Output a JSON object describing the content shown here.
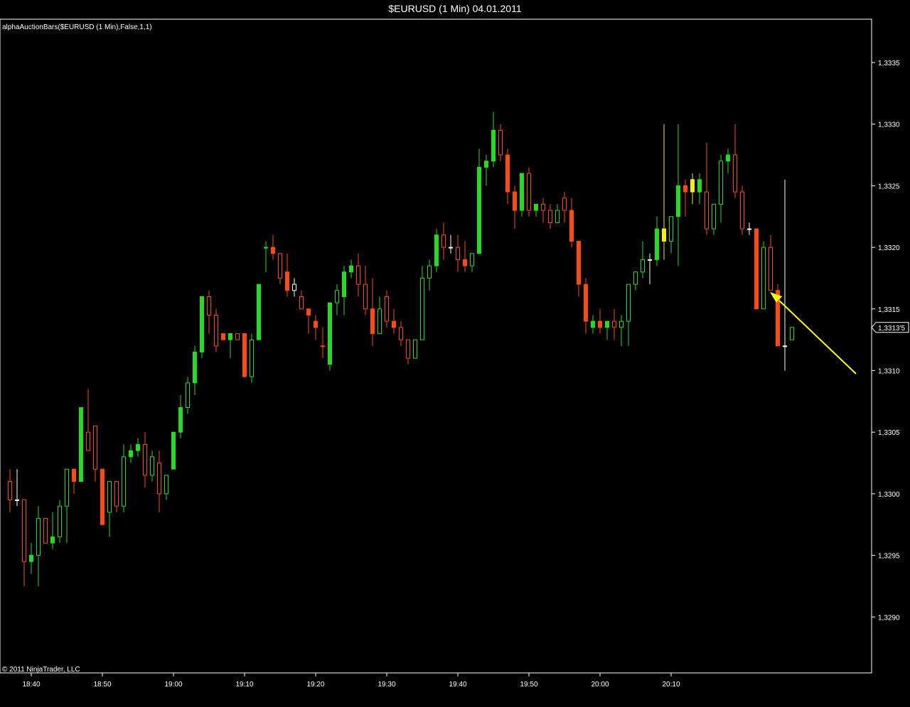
{
  "window": {
    "title": "$EURUSD (1 Min)  04.01.2011",
    "indicator_label": "alphaAuctionBars($EURUSD (1 Min),False,1,1)",
    "copyright": "© 2011 NinjaTrader, LLC",
    "current_price_label": "1,3313'5"
  },
  "colors": {
    "background": "#000000",
    "up": "#22dd22",
    "down": "#ff4a14",
    "neutral": "#ffffff",
    "yellow": "#ffee00",
    "arrow": "#ffff00",
    "axis": "#ffffff"
  },
  "chart_data": {
    "type": "candlestick",
    "title": "$EURUSD (1 Min)  04.01.2011",
    "x_tick_labels": [
      "18:40",
      "18:50",
      "19:00",
      "19:10",
      "19:20",
      "19:30",
      "19:40",
      "19:50",
      "20:00",
      "20:10"
    ],
    "y_tick_labels": [
      "1,3290",
      "1,3295",
      "1,3300",
      "1,3305",
      "1,3310",
      "1,3315",
      "1,3320",
      "1,3325",
      "1,3330",
      "1,3335"
    ],
    "y_ticks": [
      1.329,
      1.3295,
      1.33,
      1.3305,
      1.331,
      1.3315,
      1.332,
      1.3325,
      1.333,
      1.3335
    ],
    "ylim": [
      1.32845,
      1.33385
    ],
    "x_range_minutes": [
      -4,
      105
    ],
    "current_price": 1.33135,
    "annotation": "yellow arrow pointing at the last bar",
    "candles": [
      {
        "t": -3,
        "o": 1.3301,
        "h": 1.3302,
        "l": 1.32985,
        "c": 1.32995,
        "s": "down",
        "f": 0
      },
      {
        "t": -2,
        "o": 1.32995,
        "h": 1.3302,
        "l": 1.3299,
        "c": 1.32995,
        "s": "neutral",
        "f": 0
      },
      {
        "t": -1,
        "o": 1.32995,
        "h": 1.32995,
        "l": 1.32925,
        "c": 1.32945,
        "s": "down",
        "f": 0
      },
      {
        "t": 0,
        "o": 1.32945,
        "h": 1.3296,
        "l": 1.32935,
        "c": 1.3295,
        "s": "up",
        "f": 1
      },
      {
        "t": 1,
        "o": 1.3295,
        "h": 1.3299,
        "l": 1.32925,
        "c": 1.3298,
        "s": "up",
        "f": 0
      },
      {
        "t": 2,
        "o": 1.3298,
        "h": 1.3298,
        "l": 1.3296,
        "c": 1.3296,
        "s": "down",
        "f": 0
      },
      {
        "t": 3,
        "o": 1.3296,
        "h": 1.32985,
        "l": 1.32955,
        "c": 1.32965,
        "s": "up",
        "f": 1
      },
      {
        "t": 4,
        "o": 1.32965,
        "h": 1.32995,
        "l": 1.3296,
        "c": 1.3299,
        "s": "up",
        "f": 0
      },
      {
        "t": 5,
        "o": 1.3299,
        "h": 1.3302,
        "l": 1.3296,
        "c": 1.3302,
        "s": "up",
        "f": 0
      },
      {
        "t": 6,
        "o": 1.3302,
        "h": 1.3302,
        "l": 1.33,
        "c": 1.3301,
        "s": "down",
        "f": 1
      },
      {
        "t": 7,
        "o": 1.3301,
        "h": 1.3307,
        "l": 1.3301,
        "c": 1.3307,
        "s": "up",
        "f": 1
      },
      {
        "t": 8,
        "o": 1.3305,
        "h": 1.33085,
        "l": 1.33035,
        "c": 1.33035,
        "s": "down",
        "f": 0
      },
      {
        "t": 9,
        "o": 1.33055,
        "h": 1.33055,
        "l": 1.3301,
        "c": 1.3302,
        "s": "down",
        "f": 0
      },
      {
        "t": 10,
        "o": 1.3302,
        "h": 1.3302,
        "l": 1.32975,
        "c": 1.32975,
        "s": "down",
        "f": 1
      },
      {
        "t": 11,
        "o": 1.32985,
        "h": 1.3301,
        "l": 1.32965,
        "c": 1.3301,
        "s": "up",
        "f": 0
      },
      {
        "t": 12,
        "o": 1.3301,
        "h": 1.3301,
        "l": 1.32985,
        "c": 1.3299,
        "s": "down",
        "f": 0
      },
      {
        "t": 13,
        "o": 1.3299,
        "h": 1.3304,
        "l": 1.32985,
        "c": 1.3303,
        "s": "up",
        "f": 0
      },
      {
        "t": 14,
        "o": 1.3303,
        "h": 1.3304,
        "l": 1.33025,
        "c": 1.33035,
        "s": "up",
        "f": 1
      },
      {
        "t": 15,
        "o": 1.33035,
        "h": 1.33045,
        "l": 1.3303,
        "c": 1.3304,
        "s": "up",
        "f": 1
      },
      {
        "t": 16,
        "o": 1.3304,
        "h": 1.3305,
        "l": 1.33005,
        "c": 1.33015,
        "s": "down",
        "f": 0
      },
      {
        "t": 17,
        "o": 1.33015,
        "h": 1.33035,
        "l": 1.3301,
        "c": 1.3303,
        "s": "up",
        "f": 0
      },
      {
        "t": 18,
        "o": 1.33025,
        "h": 1.33035,
        "l": 1.32985,
        "c": 1.33,
        "s": "down",
        "f": 0
      },
      {
        "t": 19,
        "o": 1.33,
        "h": 1.33015,
        "l": 1.32995,
        "c": 1.33015,
        "s": "up",
        "f": 0
      },
      {
        "t": 20,
        "o": 1.3302,
        "h": 1.3305,
        "l": 1.3302,
        "c": 1.3305,
        "s": "up",
        "f": 1
      },
      {
        "t": 21,
        "o": 1.3305,
        "h": 1.3308,
        "l": 1.33045,
        "c": 1.3307,
        "s": "up",
        "f": 1
      },
      {
        "t": 22,
        "o": 1.3307,
        "h": 1.33095,
        "l": 1.33065,
        "c": 1.3309,
        "s": "up",
        "f": 0
      },
      {
        "t": 23,
        "o": 1.3309,
        "h": 1.3312,
        "l": 1.3308,
        "c": 1.33115,
        "s": "up",
        "f": 1
      },
      {
        "t": 24,
        "o": 1.33115,
        "h": 1.3316,
        "l": 1.3311,
        "c": 1.3316,
        "s": "up",
        "f": 1
      },
      {
        "t": 25,
        "o": 1.3316,
        "h": 1.33165,
        "l": 1.3313,
        "c": 1.33145,
        "s": "down",
        "f": 0
      },
      {
        "t": 26,
        "o": 1.33145,
        "h": 1.3315,
        "l": 1.33115,
        "c": 1.3312,
        "s": "down",
        "f": 0
      },
      {
        "t": 27,
        "o": 1.3313,
        "h": 1.3313,
        "l": 1.33125,
        "c": 1.33125,
        "s": "down",
        "f": 1
      },
      {
        "t": 28,
        "o": 1.33125,
        "h": 1.3313,
        "l": 1.3311,
        "c": 1.3313,
        "s": "up",
        "f": 1
      },
      {
        "t": 29,
        "o": 1.3313,
        "h": 1.3313,
        "l": 1.33125,
        "c": 1.33125,
        "s": "down",
        "f": 0
      },
      {
        "t": 30,
        "o": 1.3313,
        "h": 1.3313,
        "l": 1.33095,
        "c": 1.33095,
        "s": "down",
        "f": 1
      },
      {
        "t": 31,
        "o": 1.33095,
        "h": 1.3313,
        "l": 1.3309,
        "c": 1.33125,
        "s": "up",
        "f": 0
      },
      {
        "t": 32,
        "o": 1.33125,
        "h": 1.3317,
        "l": 1.33125,
        "c": 1.3317,
        "s": "up",
        "f": 1
      },
      {
        "t": 33,
        "o": 1.332,
        "h": 1.33205,
        "l": 1.3318,
        "c": 1.332,
        "s": "up",
        "f": 1
      },
      {
        "t": 34,
        "o": 1.332,
        "h": 1.3321,
        "l": 1.3319,
        "c": 1.33195,
        "s": "down",
        "f": 1
      },
      {
        "t": 35,
        "o": 1.33195,
        "h": 1.3319,
        "l": 1.3317,
        "c": 1.33175,
        "s": "down",
        "f": 0
      },
      {
        "t": 36,
        "o": 1.3318,
        "h": 1.33195,
        "l": 1.3316,
        "c": 1.33165,
        "s": "down",
        "f": 1
      },
      {
        "t": 37,
        "o": 1.33165,
        "h": 1.33175,
        "l": 1.3316,
        "c": 1.3317,
        "s": "neutral",
        "f": 0
      },
      {
        "t": 38,
        "o": 1.3316,
        "h": 1.33165,
        "l": 1.3315,
        "c": 1.3315,
        "s": "down",
        "f": 0
      },
      {
        "t": 39,
        "o": 1.3315,
        "h": 1.3315,
        "l": 1.3313,
        "c": 1.33145,
        "s": "down",
        "f": 1
      },
      {
        "t": 40,
        "o": 1.3314,
        "h": 1.33145,
        "l": 1.33125,
        "c": 1.33135,
        "s": "down",
        "f": 1
      },
      {
        "t": 41,
        "o": 1.3312,
        "h": 1.33135,
        "l": 1.3311,
        "c": 1.3312,
        "s": "down",
        "f": 1
      },
      {
        "t": 42,
        "o": 1.33105,
        "h": 1.33155,
        "l": 1.331,
        "c": 1.33155,
        "s": "up",
        "f": 1
      },
      {
        "t": 43,
        "o": 1.33155,
        "h": 1.3317,
        "l": 1.33145,
        "c": 1.33165,
        "s": "up",
        "f": 0
      },
      {
        "t": 44,
        "o": 1.3316,
        "h": 1.33185,
        "l": 1.33145,
        "c": 1.3318,
        "s": "up",
        "f": 1
      },
      {
        "t": 45,
        "o": 1.3318,
        "h": 1.3319,
        "l": 1.33175,
        "c": 1.33185,
        "s": "up",
        "f": 1
      },
      {
        "t": 46,
        "o": 1.33185,
        "h": 1.33195,
        "l": 1.3316,
        "c": 1.3317,
        "s": "down",
        "f": 0
      },
      {
        "t": 47,
        "o": 1.3317,
        "h": 1.33185,
        "l": 1.33145,
        "c": 1.3315,
        "s": "down",
        "f": 0
      },
      {
        "t": 48,
        "o": 1.3315,
        "h": 1.33175,
        "l": 1.3312,
        "c": 1.3313,
        "s": "down",
        "f": 1
      },
      {
        "t": 49,
        "o": 1.3313,
        "h": 1.3316,
        "l": 1.3313,
        "c": 1.3315,
        "s": "up",
        "f": 0
      },
      {
        "t": 50,
        "o": 1.3316,
        "h": 1.33165,
        "l": 1.33135,
        "c": 1.3314,
        "s": "down",
        "f": 0
      },
      {
        "t": 51,
        "o": 1.3314,
        "h": 1.3315,
        "l": 1.3313,
        "c": 1.33135,
        "s": "down",
        "f": 1
      },
      {
        "t": 52,
        "o": 1.33135,
        "h": 1.3314,
        "l": 1.3312,
        "c": 1.33125,
        "s": "down",
        "f": 0
      },
      {
        "t": 53,
        "o": 1.33125,
        "h": 1.33125,
        "l": 1.33105,
        "c": 1.3311,
        "s": "down",
        "f": 0
      },
      {
        "t": 54,
        "o": 1.3311,
        "h": 1.33125,
        "l": 1.3311,
        "c": 1.33125,
        "s": "up",
        "f": 0
      },
      {
        "t": 55,
        "o": 1.33125,
        "h": 1.33185,
        "l": 1.33125,
        "c": 1.33175,
        "s": "up",
        "f": 0
      },
      {
        "t": 56,
        "o": 1.33175,
        "h": 1.3319,
        "l": 1.33165,
        "c": 1.33185,
        "s": "up",
        "f": 0
      },
      {
        "t": 57,
        "o": 1.33185,
        "h": 1.33215,
        "l": 1.3318,
        "c": 1.3321,
        "s": "up",
        "f": 1
      },
      {
        "t": 58,
        "o": 1.3321,
        "h": 1.3322,
        "l": 1.3319,
        "c": 1.332,
        "s": "down",
        "f": 0
      },
      {
        "t": 59,
        "o": 1.332,
        "h": 1.3321,
        "l": 1.33195,
        "c": 1.332,
        "s": "neutral",
        "f": 0
      },
      {
        "t": 60,
        "o": 1.332,
        "h": 1.3321,
        "l": 1.3318,
        "c": 1.3319,
        "s": "down",
        "f": 0
      },
      {
        "t": 61,
        "o": 1.3319,
        "h": 1.33205,
        "l": 1.3318,
        "c": 1.33185,
        "s": "down",
        "f": 1
      },
      {
        "t": 62,
        "o": 1.33185,
        "h": 1.33195,
        "l": 1.3318,
        "c": 1.33195,
        "s": "up",
        "f": 0
      },
      {
        "t": 63,
        "o": 1.33195,
        "h": 1.3328,
        "l": 1.33195,
        "c": 1.33265,
        "s": "up",
        "f": 1
      },
      {
        "t": 64,
        "o": 1.33265,
        "h": 1.33275,
        "l": 1.3325,
        "c": 1.3327,
        "s": "up",
        "f": 1
      },
      {
        "t": 65,
        "o": 1.3327,
        "h": 1.3331,
        "l": 1.33265,
        "c": 1.33295,
        "s": "up",
        "f": 1
      },
      {
        "t": 66,
        "o": 1.33295,
        "h": 1.333,
        "l": 1.3327,
        "c": 1.33275,
        "s": "down",
        "f": 0
      },
      {
        "t": 67,
        "o": 1.33275,
        "h": 1.3328,
        "l": 1.33235,
        "c": 1.33245,
        "s": "down",
        "f": 1
      },
      {
        "t": 68,
        "o": 1.33245,
        "h": 1.3325,
        "l": 1.33215,
        "c": 1.3323,
        "s": "down",
        "f": 1
      },
      {
        "t": 69,
        "o": 1.3323,
        "h": 1.3326,
        "l": 1.33225,
        "c": 1.3326,
        "s": "up",
        "f": 1
      },
      {
        "t": 70,
        "o": 1.3326,
        "h": 1.33265,
        "l": 1.33225,
        "c": 1.3323,
        "s": "down",
        "f": 0
      },
      {
        "t": 71,
        "o": 1.3323,
        "h": 1.33235,
        "l": 1.33225,
        "c": 1.33235,
        "s": "up",
        "f": 1
      },
      {
        "t": 72,
        "o": 1.33235,
        "h": 1.3324,
        "l": 1.3322,
        "c": 1.3323,
        "s": "down",
        "f": 0
      },
      {
        "t": 73,
        "o": 1.3323,
        "h": 1.33235,
        "l": 1.33215,
        "c": 1.3322,
        "s": "down",
        "f": 0
      },
      {
        "t": 74,
        "o": 1.3322,
        "h": 1.33235,
        "l": 1.3322,
        "c": 1.3323,
        "s": "up",
        "f": 0
      },
      {
        "t": 75,
        "o": 1.3324,
        "h": 1.33245,
        "l": 1.3322,
        "c": 1.3323,
        "s": "down",
        "f": 0
      },
      {
        "t": 76,
        "o": 1.3323,
        "h": 1.3324,
        "l": 1.332,
        "c": 1.33205,
        "s": "down",
        "f": 1
      },
      {
        "t": 77,
        "o": 1.33205,
        "h": 1.33205,
        "l": 1.3316,
        "c": 1.3317,
        "s": "down",
        "f": 1
      },
      {
        "t": 78,
        "o": 1.3317,
        "h": 1.33175,
        "l": 1.3313,
        "c": 1.3314,
        "s": "down",
        "f": 1
      },
      {
        "t": 79,
        "o": 1.3314,
        "h": 1.33145,
        "l": 1.3313,
        "c": 1.33135,
        "s": "up",
        "f": 1
      },
      {
        "t": 80,
        "o": 1.3314,
        "h": 1.3315,
        "l": 1.3313,
        "c": 1.33135,
        "s": "down",
        "f": 1
      },
      {
        "t": 81,
        "o": 1.33135,
        "h": 1.3314,
        "l": 1.33125,
        "c": 1.3314,
        "s": "up",
        "f": 1
      },
      {
        "t": 82,
        "o": 1.3314,
        "h": 1.3315,
        "l": 1.33125,
        "c": 1.33135,
        "s": "down",
        "f": 0
      },
      {
        "t": 83,
        "o": 1.33135,
        "h": 1.33145,
        "l": 1.3312,
        "c": 1.3314,
        "s": "up",
        "f": 0
      },
      {
        "t": 84,
        "o": 1.3314,
        "h": 1.3317,
        "l": 1.3312,
        "c": 1.3317,
        "s": "up",
        "f": 0
      },
      {
        "t": 85,
        "o": 1.3317,
        "h": 1.3318,
        "l": 1.33165,
        "c": 1.3318,
        "s": "up",
        "f": 0
      },
      {
        "t": 86,
        "o": 1.3318,
        "h": 1.33205,
        "l": 1.33175,
        "c": 1.3319,
        "s": "up",
        "f": 0
      },
      {
        "t": 87,
        "o": 1.3319,
        "h": 1.33195,
        "l": 1.3317,
        "c": 1.3319,
        "s": "neutral",
        "f": 0
      },
      {
        "t": 88,
        "o": 1.3319,
        "h": 1.33225,
        "l": 1.33185,
        "c": 1.33215,
        "s": "up",
        "f": 1
      },
      {
        "t": 89,
        "o": 1.33215,
        "h": 1.333,
        "l": 1.3319,
        "c": 1.33205,
        "s": "yellow",
        "f": 1
      },
      {
        "t": 90,
        "o": 1.33205,
        "h": 1.33225,
        "l": 1.33195,
        "c": 1.33225,
        "s": "up",
        "f": 0
      },
      {
        "t": 91,
        "o": 1.33225,
        "h": 1.333,
        "l": 1.33185,
        "c": 1.3325,
        "s": "up",
        "f": 1
      },
      {
        "t": 92,
        "o": 1.3325,
        "h": 1.33255,
        "l": 1.33225,
        "c": 1.33245,
        "s": "down",
        "f": 1
      },
      {
        "t": 93,
        "o": 1.33245,
        "h": 1.3326,
        "l": 1.33235,
        "c": 1.33255,
        "s": "yellow",
        "f": 1
      },
      {
        "t": 94,
        "o": 1.33255,
        "h": 1.3326,
        "l": 1.33235,
        "c": 1.33245,
        "s": "up",
        "f": 1
      },
      {
        "t": 95,
        "o": 1.33245,
        "h": 1.33285,
        "l": 1.3321,
        "c": 1.33215,
        "s": "down",
        "f": 0
      },
      {
        "t": 96,
        "o": 1.33215,
        "h": 1.33235,
        "l": 1.3321,
        "c": 1.33235,
        "s": "up",
        "f": 0
      },
      {
        "t": 97,
        "o": 1.33235,
        "h": 1.33275,
        "l": 1.3322,
        "c": 1.3327,
        "s": "up",
        "f": 0
      },
      {
        "t": 98,
        "o": 1.3327,
        "h": 1.3328,
        "l": 1.3326,
        "c": 1.33275,
        "s": "up",
        "f": 1
      },
      {
        "t": 99,
        "o": 1.33275,
        "h": 1.333,
        "l": 1.3324,
        "c": 1.33245,
        "s": "down",
        "f": 0
      },
      {
        "t": 100,
        "o": 1.33245,
        "h": 1.3325,
        "l": 1.3321,
        "c": 1.33215,
        "s": "down",
        "f": 0
      },
      {
        "t": 101,
        "o": 1.33215,
        "h": 1.3322,
        "l": 1.3321,
        "c": 1.33215,
        "s": "neutral",
        "f": 0
      },
      {
        "t": 102,
        "o": 1.33215,
        "h": 1.33215,
        "l": 1.3315,
        "c": 1.3315,
        "s": "down",
        "f": 1
      },
      {
        "t": 103,
        "o": 1.3315,
        "h": 1.33205,
        "l": 1.3315,
        "c": 1.332,
        "s": "up",
        "f": 0
      },
      {
        "t": 104,
        "o": 1.332,
        "h": 1.3321,
        "l": 1.33165,
        "c": 1.33165,
        "s": "down",
        "f": 0
      },
      {
        "t": 105,
        "o": 1.33165,
        "h": 1.3317,
        "l": 1.3312,
        "c": 1.3312,
        "s": "down",
        "f": 1
      },
      {
        "t": 106,
        "o": 1.3312,
        "h": 1.33255,
        "l": 1.331,
        "c": 1.3312,
        "s": "neutral",
        "f": 0
      },
      {
        "t": 107,
        "o": 1.33125,
        "h": 1.33135,
        "l": 1.33125,
        "c": 1.33135,
        "s": "up",
        "f": 0
      }
    ]
  }
}
